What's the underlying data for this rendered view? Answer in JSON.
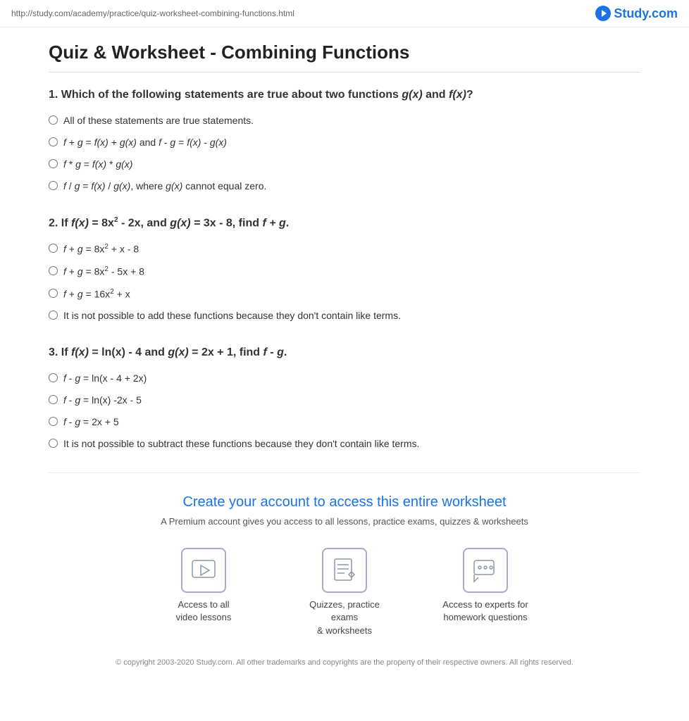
{
  "topbar": {
    "url": "http://study.com/academy/practice/quiz-worksheet-combining-functions.html",
    "logo_text": "Study.com"
  },
  "page": {
    "title": "Quiz & Worksheet - Combining Functions"
  },
  "questions": [
    {
      "number": "1",
      "text_html": "Which of the following statements are true about two functions <em>g(x)</em> and <em>f(x)</em>?",
      "options": [
        "All of these statements are true statements.",
        "f + g = f(x) + g(x) and f - g = f(x) - g(x)",
        "f * g = f(x) * g(x)",
        "f / g = f(x) / g(x), where g(x) cannot equal zero."
      ]
    },
    {
      "number": "2",
      "text_html": "If <em>f(x)</em> = 8x² - 2x, and <em>g(x)</em> = 3x - 8, find <em>f + g</em>.",
      "options": [
        "f + g = 8x² + x - 8",
        "f + g = 8x² - 5x + 8",
        "f + g = 16x² + x",
        "It is not possible to add these functions because they don't contain like terms."
      ]
    },
    {
      "number": "3",
      "text_html": "If <em>f(x)</em> = ln(x) - 4 and <em>g(x)</em> = 2x + 1, find <em>f - g</em>.",
      "options": [
        "f - g = ln(x - 4 + 2x)",
        "f - g = ln(x) -2x - 5",
        "f - g = 2x + 5",
        "It is not possible to subtract these functions because they don't contain like terms."
      ]
    }
  ],
  "cta": {
    "title": "Create your account to access this entire worksheet",
    "subtitle": "A Premium account gives you access to all lessons, practice exams, quizzes & worksheets",
    "features": [
      {
        "icon": "play",
        "text": "Access to all\nvideo lessons"
      },
      {
        "icon": "quiz",
        "text": "Quizzes, practice exams\n& worksheets"
      },
      {
        "icon": "chat",
        "text": "Access to experts for\nhomework questions"
      }
    ]
  },
  "footer": {
    "text": "© copyright 2003-2020 Study.com. All other trademarks and copyrights are the property of their respective owners. All rights reserved."
  }
}
